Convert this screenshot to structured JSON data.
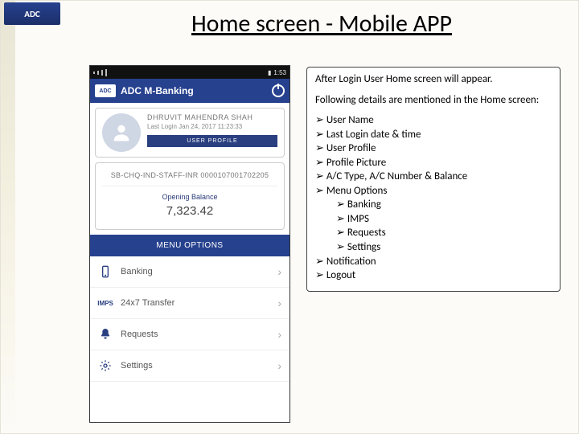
{
  "logo_text": "ADC",
  "slide_title": "Home screen - Mobile APP",
  "phone": {
    "status_time": "1:53",
    "app_title": "ADC M-Banking",
    "user_name": "DHRUVIT MAHENDRA SHAH",
    "last_login": "Last Login Jan 24, 2017 11:23:33",
    "user_profile_btn": "USER PROFILE",
    "acct_no": "SB-CHQ-IND-STAFF-INR 0000107001702205",
    "opening_balance_label": "Opening Balance",
    "opening_balance_value": "7,323.42",
    "menu_header": "MENU OPTIONS",
    "menu": [
      {
        "label": "Banking"
      },
      {
        "label": "24x7 Transfer",
        "prefix": "IMPS"
      },
      {
        "label": "Requests"
      },
      {
        "label": "Settings"
      }
    ]
  },
  "note": {
    "p1": "After Login User Home screen will appear.",
    "p2": "Following details are mentioned in the Home screen:",
    "items": [
      "User Name",
      "Last Login date & time",
      "User Profile",
      "Profile Picture",
      "A/C Type, A/C Number & Balance",
      "Menu Options"
    ],
    "subitems": [
      "Banking",
      "IMPS",
      "Requests",
      "Settings"
    ],
    "tail": [
      " Notification",
      "Logout"
    ]
  }
}
